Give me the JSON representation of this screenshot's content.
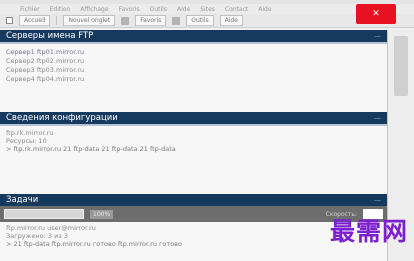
{
  "menu": [
    "Fichier",
    "Edition",
    "Affichage",
    "Favoris",
    "Outils",
    "Aide",
    "Sites",
    "Contact",
    "Aide"
  ],
  "window": {
    "close_label": "✕"
  },
  "toolbar": {
    "items": [
      "Accueil",
      "Nouvel onglet",
      "Favoris",
      "Outils",
      "Aide"
    ]
  },
  "sections": {
    "servers": {
      "title": "Серверы имена FTP",
      "items": [
        "Сервер1  ftp01.mirror.ru",
        "Сервер2  ftp02.mirror.ru",
        "Сервер3  ftp03.mirror.ru",
        "Сервер4  ftp04.mirror.ru"
      ]
    },
    "config": {
      "title": "Сведения конфигурации",
      "lines": [
        "ftp.rk.mirror.ru",
        "Ресурсы: 10",
        "> ftp.rk.mirror.ru 21 ftp-data  21  ftp-data  21  ftp-data"
      ]
    },
    "tasks": {
      "title": "Задачи",
      "progress_chip": "100%",
      "progress_label": "Скорость:"
    }
  },
  "footer": {
    "lines": [
      "ftp.mirror.ru  user@mirror.ru",
      "Загружено: 3 из 3",
      "> 21 ftp-data  ftp.mirror.ru  готово  ftp.mirror.ru  готово"
    ]
  },
  "watermark": "最需网"
}
